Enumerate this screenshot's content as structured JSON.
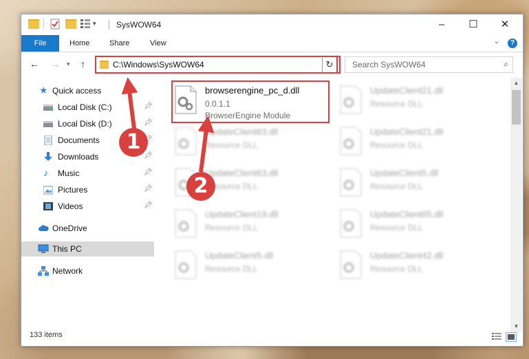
{
  "window": {
    "title": "SysWOW64",
    "controls": {
      "minimize": "–",
      "maximize": "☐",
      "close": "✕"
    }
  },
  "ribbon": {
    "file_tab": "File",
    "tabs": [
      "Home",
      "Share",
      "View"
    ],
    "help": "?"
  },
  "address": {
    "path": "C:\\Windows\\SysWOW64"
  },
  "search": {
    "placeholder": "Search SysWOW64"
  },
  "nav": {
    "items": [
      {
        "label": "Quick access",
        "icon": "star-icon",
        "pinned": false
      },
      {
        "label": "Local Disk (C:)",
        "icon": "drive-icon",
        "pinned": true
      },
      {
        "label": "Local Disk (D:)",
        "icon": "drive-icon",
        "pinned": true
      },
      {
        "label": "Documents",
        "icon": "documents-icon",
        "pinned": true
      },
      {
        "label": "Downloads",
        "icon": "downloads-icon",
        "pinned": true
      },
      {
        "label": "Music",
        "icon": "music-icon",
        "pinned": true
      },
      {
        "label": "Pictures",
        "icon": "pictures-icon",
        "pinned": true
      },
      {
        "label": "Videos",
        "icon": "videos-icon",
        "pinned": true
      },
      {
        "label": "OneDrive",
        "icon": "cloud-icon",
        "pinned": false
      },
      {
        "label": "This PC",
        "icon": "computer-icon",
        "pinned": false
      },
      {
        "label": "Network",
        "icon": "network-icon",
        "pinned": false
      }
    ]
  },
  "files": {
    "highlighted": {
      "name": "browserengine_pc_d.dll",
      "version": "0.0.1.1",
      "description": "BrowserEngine Module"
    },
    "others": [
      {
        "name": "UpdateClient21.dll",
        "description": "Resource DLL"
      },
      {
        "name": "UpdateClient63.dll",
        "description": "Resource DLL"
      },
      {
        "name": "UpdateClient21.dll",
        "description": "Resource DLL"
      },
      {
        "name": "UpdateClient63.dll",
        "description": "Resource DLL"
      },
      {
        "name": "UpdateClient5.dll",
        "description": "Resource DLL"
      },
      {
        "name": "UpdateClient19.dll",
        "description": "Resource DLL"
      },
      {
        "name": "UpdateClient65.dll",
        "description": "Resource DLL"
      },
      {
        "name": "UpdateClient5.dll",
        "description": "Resource DLL"
      },
      {
        "name": "UpdateClient42.dll",
        "description": "Resource DLL"
      }
    ]
  },
  "status": {
    "count": "133 items"
  },
  "callouts": [
    "1",
    "2"
  ],
  "colors": {
    "accent": "#1979ca",
    "highlight_red": "#d9413f",
    "selection": "#d9d9d9"
  }
}
